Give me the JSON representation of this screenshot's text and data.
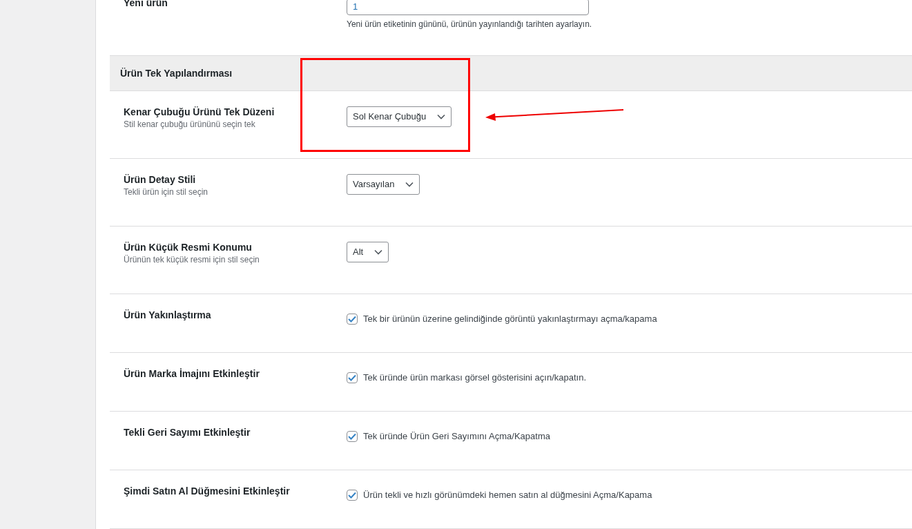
{
  "top_field": {
    "label": "Yeni ürün",
    "value": "1",
    "help": "Yeni ürün etiketinin gününü, ürünün yayınlandığı tarihten ayarlayın."
  },
  "section": {
    "title": "Ürün Tek Yapılandırması"
  },
  "rows": [
    {
      "kind": "select",
      "label": "Kenar Çubuğu Ürünü Tek Düzeni",
      "description": "Stil kenar çubuğu ürününü seçin tek",
      "value": "Sol Kenar Çubuğu"
    },
    {
      "kind": "select",
      "label": "Ürün Detay Stili",
      "description": "Tekli ürün için stil seçin",
      "value": "Varsayılan"
    },
    {
      "kind": "select",
      "label": "Ürün Küçük Resmi Konumu",
      "description": "Ürünün tek küçük resmi için stil seçin",
      "value": "Alt"
    },
    {
      "kind": "checkbox",
      "label": "Ürün Yakınlaştırma",
      "checked": true,
      "text": "Tek bir ürünün üzerine gelindiğinde görüntü yakınlaştırmayı açma/kapama"
    },
    {
      "kind": "checkbox",
      "label": "Ürün Marka İmajını Etkinleştir",
      "checked": true,
      "text": "Tek üründe ürün markası görsel gösterisini açın/kapatın."
    },
    {
      "kind": "checkbox",
      "label": "Tekli Geri Sayımı Etkinleştir",
      "checked": true,
      "text": "Tek üründe Ürün Geri Sayımını Açma/Kapatma"
    },
    {
      "kind": "checkbox",
      "label": "Şimdi Satın Al Düğmesini Etkinleştir",
      "checked": true,
      "text": "Ürün tekli ve hızlı görünümdeki hemen satın al düğmesini Açma/Kapama"
    }
  ],
  "annotations": [
    {
      "kind": "highlight-box"
    },
    {
      "kind": "arrow"
    }
  ]
}
